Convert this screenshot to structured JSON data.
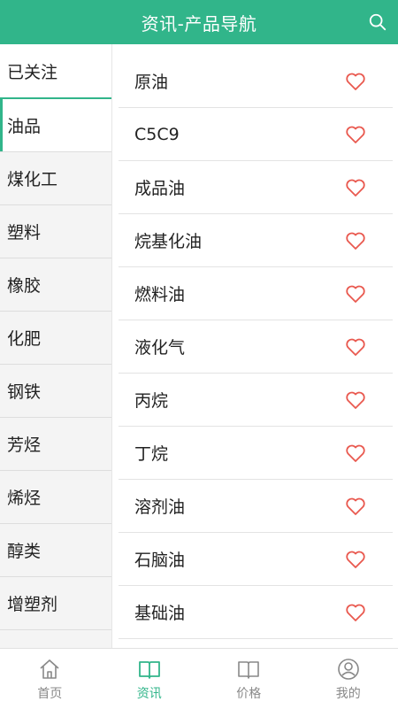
{
  "header": {
    "title": "资讯-产品导航",
    "search_icon": "search-icon"
  },
  "colors": {
    "accent": "#31b58a",
    "heart": "#e9594f"
  },
  "categories": [
    {
      "label": "已关注"
    },
    {
      "label": "油品"
    },
    {
      "label": "煤化工"
    },
    {
      "label": "塑料"
    },
    {
      "label": "橡胶"
    },
    {
      "label": "化肥"
    },
    {
      "label": "钢铁"
    },
    {
      "label": "芳烃"
    },
    {
      "label": "烯烃"
    },
    {
      "label": "醇类"
    },
    {
      "label": "增塑剂"
    }
  ],
  "selected_category": "油品",
  "products": [
    {
      "name": "原油"
    },
    {
      "name": "C5C9"
    },
    {
      "name": "成品油"
    },
    {
      "name": "烷基化油"
    },
    {
      "name": "燃料油"
    },
    {
      "name": "液化气"
    },
    {
      "name": "丙烷"
    },
    {
      "name": "丁烷"
    },
    {
      "name": "溶剂油"
    },
    {
      "name": "石脑油"
    },
    {
      "name": "基础油"
    }
  ],
  "tabs": [
    {
      "label": "首页",
      "icon": "home-icon"
    },
    {
      "label": "资讯",
      "icon": "book-icon",
      "active": true
    },
    {
      "label": "价格",
      "icon": "book-outline-icon"
    },
    {
      "label": "我的",
      "icon": "user-icon"
    }
  ]
}
